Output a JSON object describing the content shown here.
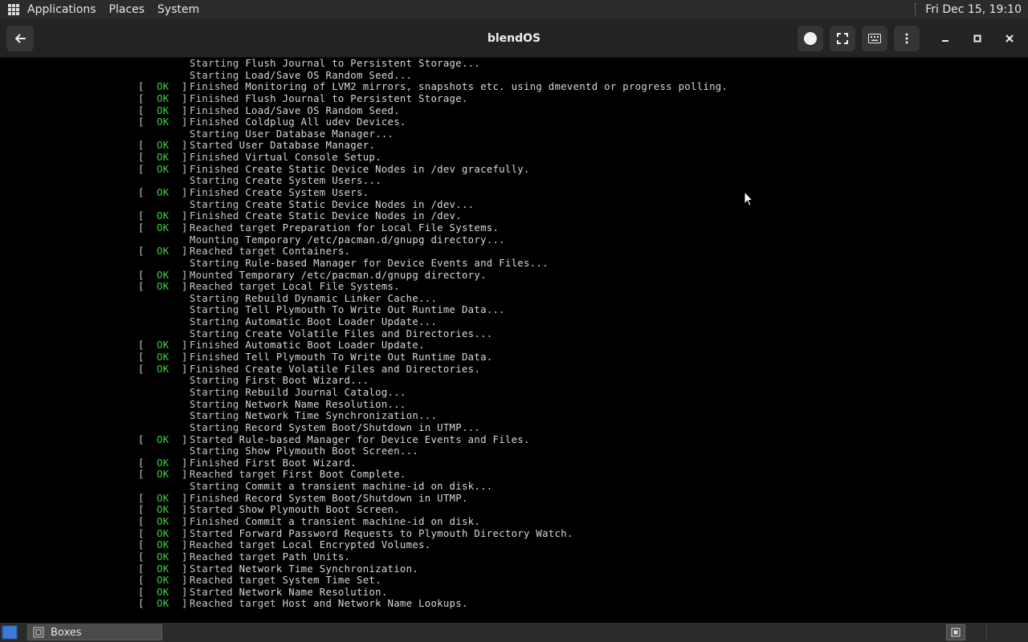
{
  "top_panel": {
    "menus": [
      "Applications",
      "Places",
      "System"
    ],
    "clock": "Fri Dec 15, 19:10"
  },
  "header": {
    "title": "blendOS"
  },
  "icons": {
    "back": "arrow-left-icon",
    "ctrl_alt_del": "circle-icon",
    "fullscreen": "fullscreen-icon",
    "keyboard": "keyboard-icon",
    "menu": "vertical-ellipsis-icon",
    "minimize": "minimize-icon",
    "maximize": "maximize-icon",
    "close": "close-icon",
    "apps": "grid-icon"
  },
  "colors": {
    "ok": "#3fd23f",
    "console_bg": "#000000",
    "panel_bg": "#2b2b2b",
    "header_bg": "#232323"
  },
  "console": {
    "ok_status": "[  OK  ]",
    "lines": [
      {
        "ok": false,
        "verb": "Starting",
        "text": "Flush Journal to Persistent Storage..."
      },
      {
        "ok": false,
        "verb": "Starting",
        "text": "Load/Save OS Random Seed..."
      },
      {
        "ok": true,
        "verb": "Finished",
        "text": "Monitoring of LVM2 mirrors, snapshots etc. using dmeventd or progress polling."
      },
      {
        "ok": true,
        "verb": "Finished",
        "text": "Flush Journal to Persistent Storage."
      },
      {
        "ok": true,
        "verb": "Finished",
        "text": "Load/Save OS Random Seed."
      },
      {
        "ok": true,
        "verb": "Finished",
        "text": "Coldplug All udev Devices."
      },
      {
        "ok": false,
        "verb": "Starting",
        "text": "User Database Manager..."
      },
      {
        "ok": true,
        "verb": "Started",
        "text": "User Database Manager."
      },
      {
        "ok": true,
        "verb": "Finished",
        "text": "Virtual Console Setup."
      },
      {
        "ok": true,
        "verb": "Finished",
        "text": "Create Static Device Nodes in /dev gracefully."
      },
      {
        "ok": false,
        "verb": "Starting",
        "text": "Create System Users..."
      },
      {
        "ok": true,
        "verb": "Finished",
        "text": "Create System Users."
      },
      {
        "ok": false,
        "verb": "Starting",
        "text": "Create Static Device Nodes in /dev..."
      },
      {
        "ok": true,
        "verb": "Finished",
        "text": "Create Static Device Nodes in /dev."
      },
      {
        "ok": true,
        "verb": "Reached target",
        "text": "Preparation for Local File Systems."
      },
      {
        "ok": false,
        "verb": "Mounting",
        "text": "Temporary /etc/pacman.d/gnupg directory..."
      },
      {
        "ok": true,
        "verb": "Reached target",
        "text": "Containers."
      },
      {
        "ok": false,
        "verb": "Starting",
        "text": "Rule-based Manager for Device Events and Files..."
      },
      {
        "ok": true,
        "verb": "Mounted",
        "text": "Temporary /etc/pacman.d/gnupg directory."
      },
      {
        "ok": true,
        "verb": "Reached target",
        "text": "Local File Systems."
      },
      {
        "ok": false,
        "verb": "Starting",
        "text": "Rebuild Dynamic Linker Cache..."
      },
      {
        "ok": false,
        "verb": "Starting",
        "text": "Tell Plymouth To Write Out Runtime Data..."
      },
      {
        "ok": false,
        "verb": "Starting",
        "text": "Automatic Boot Loader Update..."
      },
      {
        "ok": false,
        "verb": "Starting",
        "text": "Create Volatile Files and Directories..."
      },
      {
        "ok": true,
        "verb": "Finished",
        "text": "Automatic Boot Loader Update."
      },
      {
        "ok": true,
        "verb": "Finished",
        "text": "Tell Plymouth To Write Out Runtime Data."
      },
      {
        "ok": true,
        "verb": "Finished",
        "text": "Create Volatile Files and Directories."
      },
      {
        "ok": false,
        "verb": "Starting",
        "text": "First Boot Wizard..."
      },
      {
        "ok": false,
        "verb": "Starting",
        "text": "Rebuild Journal Catalog..."
      },
      {
        "ok": false,
        "verb": "Starting",
        "text": "Network Name Resolution..."
      },
      {
        "ok": false,
        "verb": "Starting",
        "text": "Network Time Synchronization..."
      },
      {
        "ok": false,
        "verb": "Starting",
        "text": "Record System Boot/Shutdown in UTMP..."
      },
      {
        "ok": true,
        "verb": "Started",
        "text": "Rule-based Manager for Device Events and Files."
      },
      {
        "ok": false,
        "verb": "Starting",
        "text": "Show Plymouth Boot Screen..."
      },
      {
        "ok": true,
        "verb": "Finished",
        "text": "First Boot Wizard."
      },
      {
        "ok": true,
        "verb": "Reached target",
        "text": "First Boot Complete."
      },
      {
        "ok": false,
        "verb": "Starting",
        "text": "Commit a transient machine-id on disk..."
      },
      {
        "ok": true,
        "verb": "Finished",
        "text": "Record System Boot/Shutdown in UTMP."
      },
      {
        "ok": true,
        "verb": "Started",
        "text": "Show Plymouth Boot Screen."
      },
      {
        "ok": true,
        "verb": "Finished",
        "text": "Commit a transient machine-id on disk."
      },
      {
        "ok": true,
        "verb": "Started",
        "text": "Forward Password Requests to Plymouth Directory Watch."
      },
      {
        "ok": true,
        "verb": "Reached target",
        "text": "Local Encrypted Volumes."
      },
      {
        "ok": true,
        "verb": "Reached target",
        "text": "Path Units."
      },
      {
        "ok": true,
        "verb": "Started",
        "text": "Network Time Synchronization."
      },
      {
        "ok": true,
        "verb": "Reached target",
        "text": "System Time Set."
      },
      {
        "ok": true,
        "verb": "Started",
        "text": "Network Name Resolution."
      },
      {
        "ok": true,
        "verb": "Reached target",
        "text": "Host and Network Name Lookups."
      }
    ]
  },
  "taskbar": {
    "items": [
      {
        "label": "Boxes",
        "icon": "boxes-app-icon"
      }
    ]
  }
}
